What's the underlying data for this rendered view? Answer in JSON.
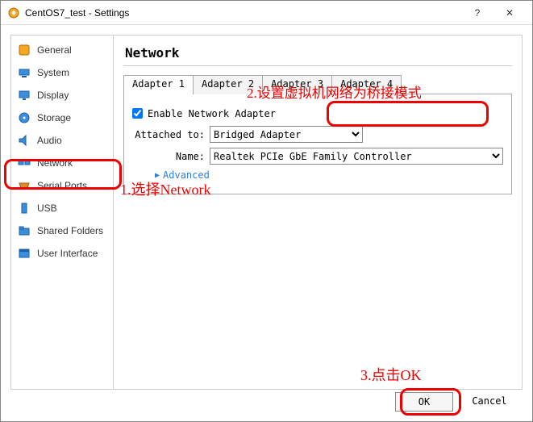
{
  "window": {
    "title": "CentOS7_test - Settings",
    "help": "?",
    "close": "✕"
  },
  "sidebar": {
    "items": [
      {
        "label": "General"
      },
      {
        "label": "System"
      },
      {
        "label": "Display"
      },
      {
        "label": "Storage"
      },
      {
        "label": "Audio"
      },
      {
        "label": "Network"
      },
      {
        "label": "Serial Ports"
      },
      {
        "label": "USB"
      },
      {
        "label": "Shared Folders"
      },
      {
        "label": "User Interface"
      }
    ],
    "selected_index": 5
  },
  "page": {
    "title": "Network",
    "tabs": [
      "Adapter 1",
      "Adapter 2",
      "Adapter 3",
      "Adapter 4"
    ],
    "active_tab": 0,
    "enable_label": "Enable Network Adapter",
    "enable_checked": true,
    "attached_label": "Attached to:",
    "attached_value": "Bridged Adapter",
    "name_label": "Name:",
    "name_value": "Realtek PCIe GbE Family Controller",
    "advanced_label": "Advanced"
  },
  "annotations": {
    "a1": "1.选择Network",
    "a2": "2.设置虚拟机网络为桥接模式",
    "a3": "3.点击OK"
  },
  "footer": {
    "ok": "OK",
    "cancel": "Cancel"
  }
}
